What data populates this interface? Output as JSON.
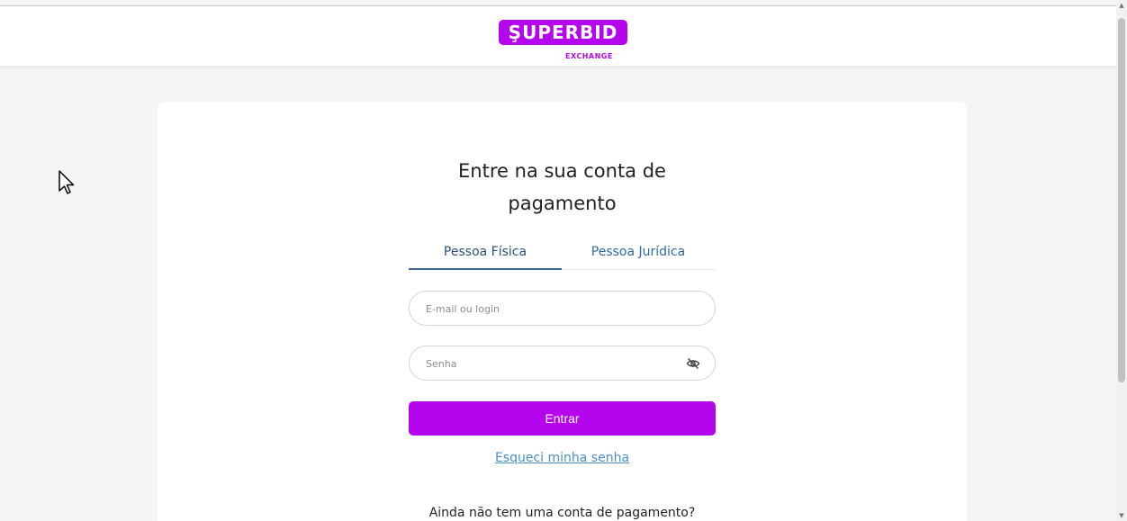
{
  "header": {
    "logo_text": "ŞUPERBID",
    "logo_sub": "EXCHANGE"
  },
  "login": {
    "title": "Entre na sua conta de pagamento",
    "tabs": [
      {
        "label": "Pessoa Física",
        "active": true
      },
      {
        "label": "Pessoa Jurídica",
        "active": false
      }
    ],
    "email_placeholder": "E-mail ou login",
    "password_placeholder": "Senha",
    "submit_label": "Entrar",
    "forgot_link": "Esqueci minha senha",
    "signup_question": "Ainda não tem uma conta de pagamento?"
  },
  "icons": {
    "password_toggle": "eye-off-icon",
    "cursor": "mouse-pointer"
  },
  "colors": {
    "brand": "#b405ec",
    "tab_active": "#3d6590",
    "link": "#4a90c9"
  }
}
